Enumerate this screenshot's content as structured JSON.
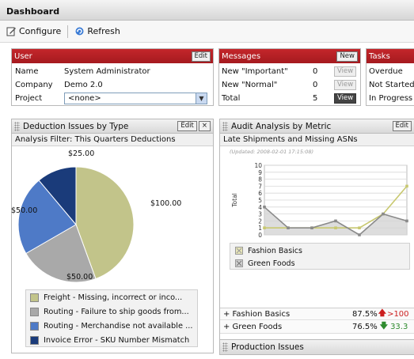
{
  "header": {
    "title": "Dashboard"
  },
  "toolbar": {
    "configure": "Configure",
    "refresh": "Refresh"
  },
  "user": {
    "title": "User",
    "edit": "Edit",
    "name_label": "Name",
    "name_value": "System Administrator",
    "company_label": "Company",
    "company_value": "Demo 2.0",
    "project_label": "Project",
    "project_value": "<none>"
  },
  "messages": {
    "title": "Messages",
    "new": "New",
    "rows": [
      {
        "label": "New \"Important\"",
        "count": "0",
        "action": "View"
      },
      {
        "label": "New \"Normal\"",
        "count": "0",
        "action": "View"
      },
      {
        "label": "Total",
        "count": "5",
        "action": "View"
      }
    ]
  },
  "tasks": {
    "title": "Tasks",
    "rows": [
      "Overdue",
      "Not Started",
      "In Progress"
    ]
  },
  "deduction": {
    "title": "Deduction Issues by Type",
    "edit": "Edit",
    "filter": "Analysis Filter: This Quarters Deductions",
    "legend": [
      {
        "label": "Freight - Missing, incorrect or inco...",
        "color": "#c2c48a"
      },
      {
        "label": "Routing - Failure to ship goods from...",
        "color": "#a9a9a9"
      },
      {
        "label": "Routing - Merchandise not available ...",
        "color": "#4e7ac7"
      },
      {
        "label": "Invoice Error - SKU Number Mismatch",
        "color": "#1a3b7a"
      }
    ]
  },
  "audit": {
    "title": "Audit Analysis by Metric",
    "edit": "Edit",
    "subtitle": "Late Shipments and Missing ASNs",
    "updated": "(Updated: 2008-02-01 17:15:08)",
    "metrics": [
      {
        "name": "+ Fashion Basics",
        "value": "87.5%",
        "trend": ">100"
      },
      {
        "name": "+ Green Foods",
        "value": "76.5%",
        "trend": "33.3"
      }
    ]
  },
  "production": {
    "title": "Production Issues"
  },
  "chart_data": [
    {
      "type": "pie",
      "title": "Deduction Issues by Type",
      "slices": [
        {
          "label": "Freight - Missing, incorrect or inco...",
          "value": 100,
          "display": "$100.00",
          "color": "#c2c48a"
        },
        {
          "label": "Routing - Failure to ship goods from...",
          "value": 50,
          "display": "$50.00",
          "color": "#a9a9a9"
        },
        {
          "label": "Routing - Merchandise not available ...",
          "value": 50,
          "display": "$50.00",
          "color": "#4e7ac7"
        },
        {
          "label": "Invoice Error - SKU Number Mismatch",
          "value": 25,
          "display": "$25.00",
          "color": "#1a3b7a"
        }
      ]
    },
    {
      "type": "line",
      "title": "Late Shipments and Missing ASNs",
      "ylabel": "Total",
      "ylim": [
        0,
        10
      ],
      "yticks": [
        "0",
        "1",
        "2",
        "3",
        "4",
        "5",
        "6",
        "7",
        "8",
        "9",
        "10"
      ],
      "series": [
        {
          "name": "Fashion Basics",
          "color": "#c8c870",
          "values": [
            1,
            1,
            1,
            1,
            1,
            3,
            7
          ]
        },
        {
          "name": "Green Foods",
          "color": "#8a8a8a",
          "values": [
            4,
            1,
            1,
            2,
            0,
            3,
            2
          ]
        }
      ]
    }
  ]
}
